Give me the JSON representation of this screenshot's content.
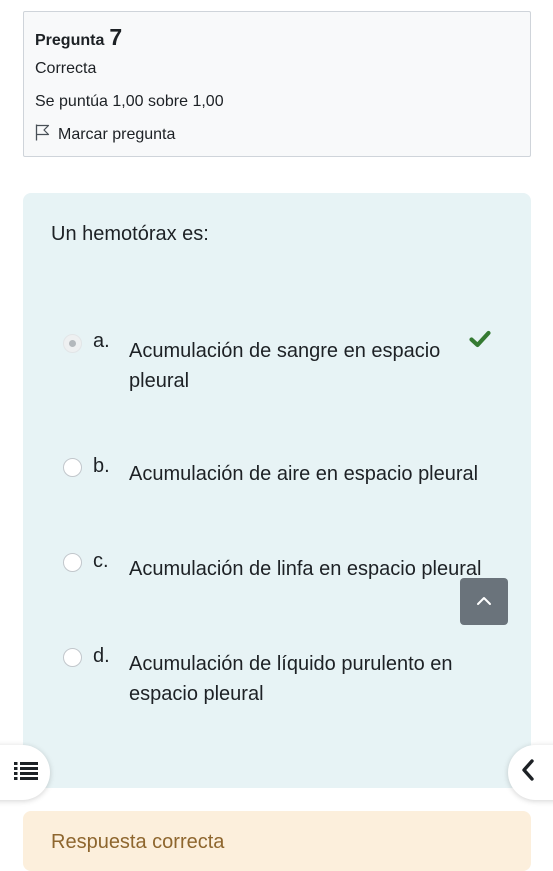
{
  "info": {
    "question_label": "Pregunta",
    "question_number": "7",
    "status": "Correcta",
    "grade": "Se puntúa 1,00 sobre 1,00",
    "flag_label": "Marcar pregunta"
  },
  "question": {
    "text": "Un hemotórax es:",
    "answers": [
      {
        "letter": "a.",
        "text": "Acumulación de sangre en espacio pleural",
        "selected": true,
        "correct": true
      },
      {
        "letter": "b.",
        "text": "Acumulación de aire en espacio pleural",
        "selected": false
      },
      {
        "letter": "c.",
        "text": "Acumulación de linfa en espacio pleural",
        "selected": false
      },
      {
        "letter": "d.",
        "text": "Acumulación de líquido purulento en espacio pleural",
        "selected": false
      }
    ]
  },
  "feedback": {
    "label": "Respuesta correcta"
  },
  "icons": {
    "flag": "flag-icon",
    "correct": "check-icon",
    "scroll_top": "chevron-up-icon",
    "index": "list-icon",
    "drawer_toggle": "chevron-left-icon"
  },
  "colors": {
    "question_bg": "#e7f3f5",
    "feedback_bg": "#fcefdc",
    "correct": "#357a32",
    "scroll_button": "#6a737b"
  }
}
